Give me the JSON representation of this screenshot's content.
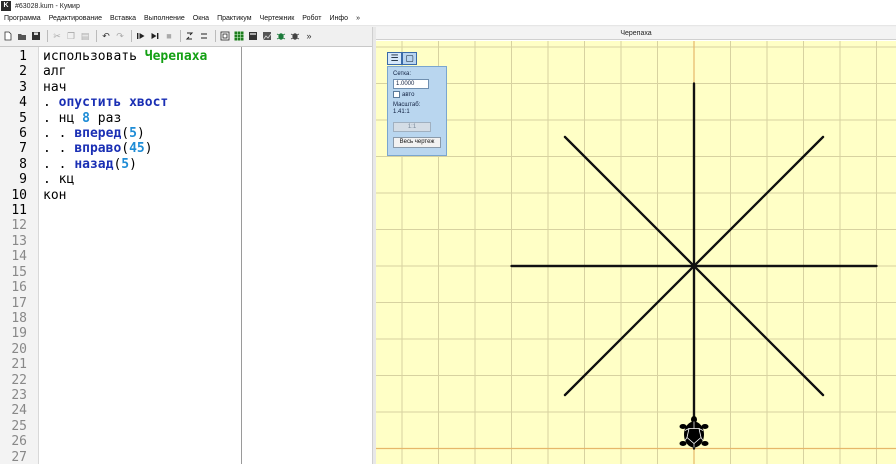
{
  "window": {
    "title": "#63028.kum - Кумир",
    "app_icon_letter": "K"
  },
  "menu": [
    "Программа",
    "Редактирование",
    "Вставка",
    "Выполнение",
    "Окна",
    "Практикум",
    "Чертежник",
    "Робот",
    "Инфо",
    "»"
  ],
  "toolbar_icons": [
    "new-file-icon",
    "open-folder-icon",
    "save-icon",
    "cut-icon",
    "copy-icon",
    "paste-icon",
    "undo-icon",
    "redo-icon",
    "run-icon",
    "run-step-icon",
    "step-over-icon",
    "stop-icon",
    "step-in-icon",
    "step-out-icon",
    "drawer-icon",
    "robot-field-icon",
    "tool-a-icon",
    "tool-b-icon",
    "bug-icon",
    "bug-alt-icon",
    "more-icon"
  ],
  "toolbar_more_label": "»",
  "editor": {
    "line_numbers": [
      "1",
      "2",
      "3",
      "4",
      "5",
      "6",
      "7",
      "8",
      "9",
      "10",
      "11",
      "12",
      "13",
      "14",
      "15",
      "16",
      "17",
      "18",
      "19",
      "20",
      "21",
      "22",
      "23",
      "24",
      "25",
      "26",
      "27"
    ],
    "code_lines": [
      [
        {
          "t": "использовать ",
          "c": "kw"
        },
        {
          "t": "Черепаха",
          "c": "mod"
        }
      ],
      [
        {
          "t": "алг",
          "c": "kw"
        }
      ],
      [
        {
          "t": "нач",
          "c": "kw"
        }
      ],
      [
        {
          "t": ". ",
          "c": "kw"
        },
        {
          "t": "опустить хвост",
          "c": "proc"
        }
      ],
      [
        {
          "t": ". нц ",
          "c": "kw"
        },
        {
          "t": "8",
          "c": "num"
        },
        {
          "t": " раз",
          "c": "kw"
        }
      ],
      [
        {
          "t": ". . ",
          "c": "kw"
        },
        {
          "t": "вперед",
          "c": "proc"
        },
        {
          "t": "(",
          "c": "kw"
        },
        {
          "t": "5",
          "c": "num"
        },
        {
          "t": ")",
          "c": "kw"
        }
      ],
      [
        {
          "t": ". . ",
          "c": "kw"
        },
        {
          "t": "вправо",
          "c": "proc"
        },
        {
          "t": "(",
          "c": "kw"
        },
        {
          "t": "45",
          "c": "num"
        },
        {
          "t": ")",
          "c": "kw"
        }
      ],
      [
        {
          "t": ". . ",
          "c": "kw"
        },
        {
          "t": "назад",
          "c": "proc"
        },
        {
          "t": "(",
          "c": "kw"
        },
        {
          "t": "5",
          "c": "num"
        },
        {
          "t": ")",
          "c": "kw"
        }
      ],
      [
        {
          "t": ". кц",
          "c": "kw"
        }
      ],
      [
        {
          "t": "кон",
          "c": "kw"
        }
      ]
    ],
    "active_line_count": 11
  },
  "turtle": {
    "header_title": "Черепаха",
    "panel": {
      "tab_icons": [
        "list-icon",
        "grid-icon"
      ],
      "grid_label": "Сетка:",
      "grid_value": "1.0000",
      "auto_label": "авто",
      "scale_label": "Масштаб:",
      "scale_value": "1.41:1",
      "one_to_one_label": "1:1",
      "whole_drawing_label": "Весь чертеж"
    },
    "drawing": {
      "rays": 8,
      "ray_length": 5,
      "turn_angle": 45,
      "line_color": "#111111",
      "grid_fill": "#ffffc6",
      "grid_line_color": "#d7d2a0",
      "axis_color": "#e6b76a"
    }
  }
}
